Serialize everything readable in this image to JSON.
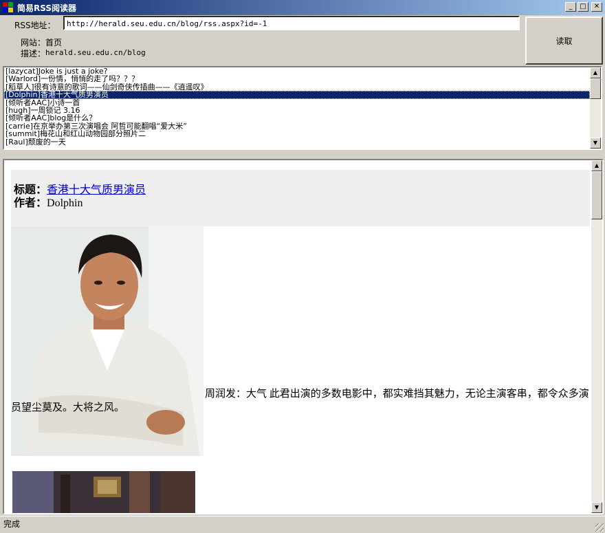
{
  "window": {
    "title": "简易RSS阅读器",
    "controls": {
      "minimize": "_",
      "maximize": "□",
      "close": "✕"
    }
  },
  "form": {
    "rss_label": "RSS地址：",
    "rss_value": "http://herald.seu.edu.cn/blog/rss.aspx?id=-1",
    "site_label": "网站：",
    "site_value": "首页",
    "desc_label": "描述：",
    "desc_value": "herald.seu.edu.cn/blog",
    "read_button": "读取"
  },
  "list": {
    "selected_index": 3,
    "items": [
      "[lazycat]Joke is just a joke?",
      "[Warlord]一份情，悄悄的走了吗？？？",
      "[稻草人]很有诗意的歌词——仙剑奇侠传插曲——《逍遥叹》",
      "[Dolphin]香港十大气质男演员",
      "[倾听者AAC]小诗一首",
      "[hugh]一周锁记 3.16",
      "[倾听者AAC]blog是什么？",
      "[carrie]在京举办第三次演唱会 阿哲可能翻唱“爱大米”",
      "[summit]梅花山和红山动物园部分照片二",
      "[Raul]颓废的一天"
    ]
  },
  "article": {
    "title_label": "标题：",
    "title_link": "香港十大气质男演员",
    "author_label": "作者：",
    "author_value": "Dolphin",
    "body": "周润发：大气 此君出演的多数电影中，都实难挡其魅力，无论主演客串，都令众多演员望尘莫及。大将之风。"
  },
  "status": {
    "text": "完成"
  },
  "colors": {
    "titlebar_start": "#0a246a",
    "titlebar_end": "#a6caf0",
    "selection": "#0a246a",
    "link": "#0000cc",
    "face": "#d4d0c8"
  }
}
